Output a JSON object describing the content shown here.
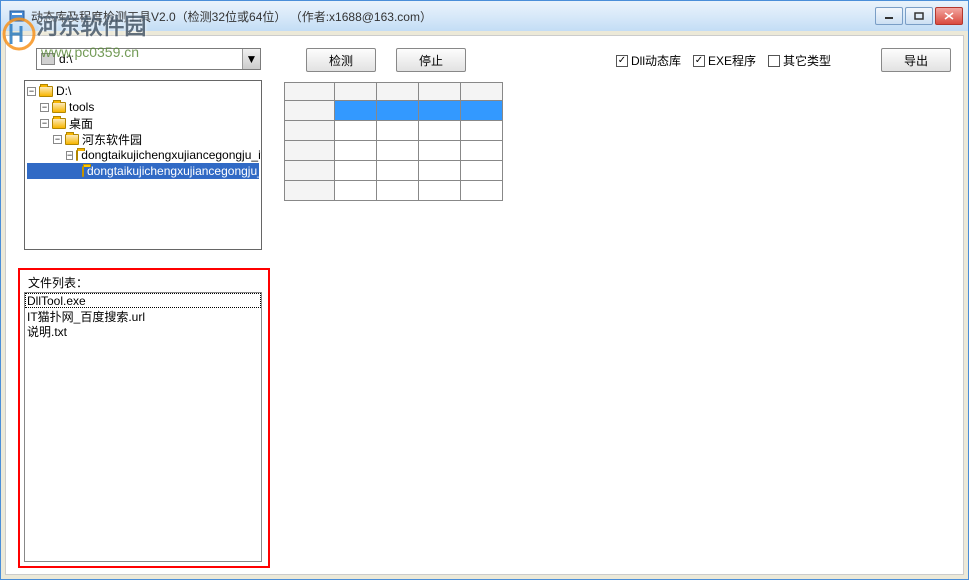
{
  "titlebar": {
    "title": "动态库及程度检测工具V2.0（检测32位或64位）       （作者:x1688@163.com）"
  },
  "watermark": {
    "brand": "河东软件园",
    "url": "www.pc0359.cn"
  },
  "toolbar": {
    "drive_value": "d:\\",
    "detect_label": "检测",
    "stop_label": "停止",
    "export_label": "导出"
  },
  "checkboxes": {
    "dll": {
      "label": "Dll动态库",
      "checked": true
    },
    "exe": {
      "label": "EXE程序",
      "checked": true
    },
    "other": {
      "label": "其它类型",
      "checked": false
    }
  },
  "tree": {
    "items": [
      {
        "label": "D:\\",
        "indent": 0,
        "exp": "-"
      },
      {
        "label": "tools",
        "indent": 1,
        "exp": "-"
      },
      {
        "label": "桌面",
        "indent": 1,
        "exp": "-"
      },
      {
        "label": "河东软件园",
        "indent": 2,
        "exp": "-"
      },
      {
        "label": "dongtaikujichengxujiancegongju_itmop.c",
        "indent": 3,
        "exp": "-"
      },
      {
        "label": "dongtaikujichengxujiancegongju_itmop.",
        "indent": 4,
        "exp": "",
        "sel": true
      }
    ]
  },
  "filelist": {
    "label": "文件列表：",
    "items": [
      "DllTool.exe",
      "IT猫扑网_百度搜索.url",
      "说明.txt"
    ]
  }
}
